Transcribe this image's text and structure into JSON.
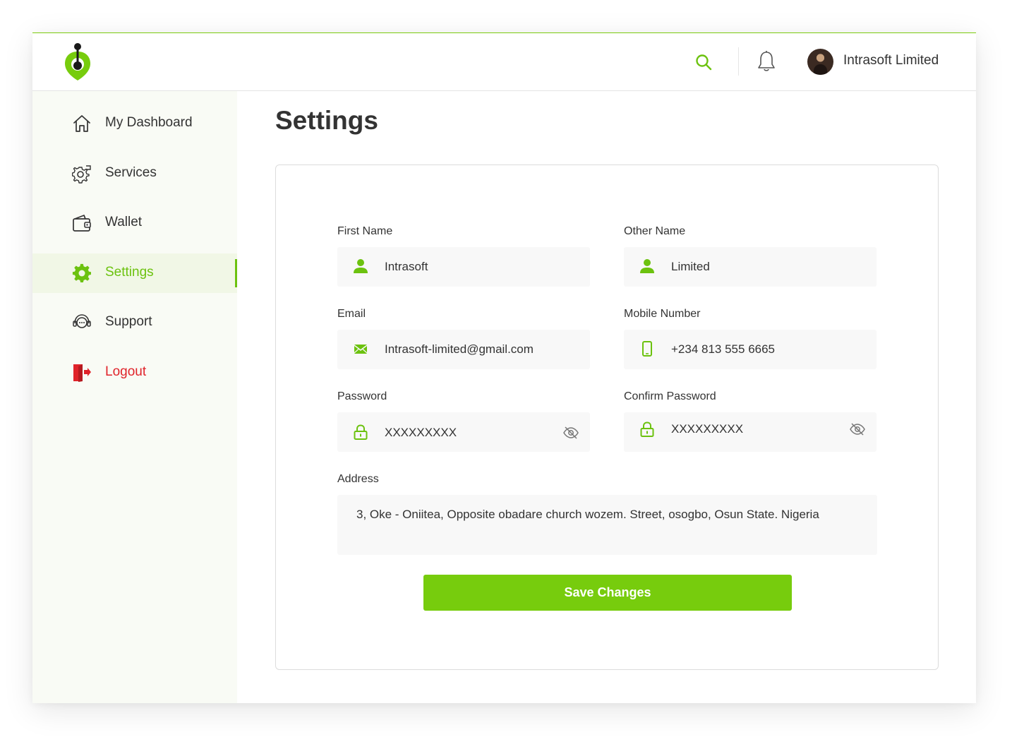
{
  "brand": {
    "accent": "#77cc0d",
    "danger": "#e0232a",
    "logo_icon": "brand-logo-icon"
  },
  "header": {
    "user_name": "Intrasoft Limited",
    "search_icon": "search-icon",
    "bell_icon": "bell-icon"
  },
  "sidebar": {
    "items": [
      {
        "label": "My Dashboard",
        "icon": "home-icon"
      },
      {
        "label": "Services",
        "icon": "services-gear-icon"
      },
      {
        "label": "Wallet",
        "icon": "wallet-icon"
      },
      {
        "label": "Settings",
        "icon": "gear-icon",
        "active": true
      },
      {
        "label": "Support",
        "icon": "headset-icon"
      },
      {
        "label": "Logout",
        "icon": "logout-icon"
      }
    ]
  },
  "main": {
    "title": "Settings",
    "form": {
      "first_name": {
        "label": "First Name",
        "value": "Intrasoft",
        "icon": "user-icon"
      },
      "other_name": {
        "label": "Other Name",
        "value": "Limited",
        "icon": "user-icon"
      },
      "email": {
        "label": "Email",
        "value": "Intrasoft-limited@gmail.com",
        "icon": "mail-icon"
      },
      "mobile": {
        "label": "Mobile Number",
        "value": "+234 813 555 6665",
        "icon": "phone-icon"
      },
      "password": {
        "label": "Password",
        "value": "XXXXXXXXX",
        "icon": "lock-icon"
      },
      "confirm_password": {
        "label": "Confirm Password",
        "value": "XXXXXXXXX",
        "icon": "lock-icon"
      },
      "address": {
        "label": "Address",
        "value": "3, Oke - Oniitea, Opposite obadare church wozem. Street, osogbo, Osun State. Nigeria"
      },
      "save_label": "Save Changes"
    }
  }
}
